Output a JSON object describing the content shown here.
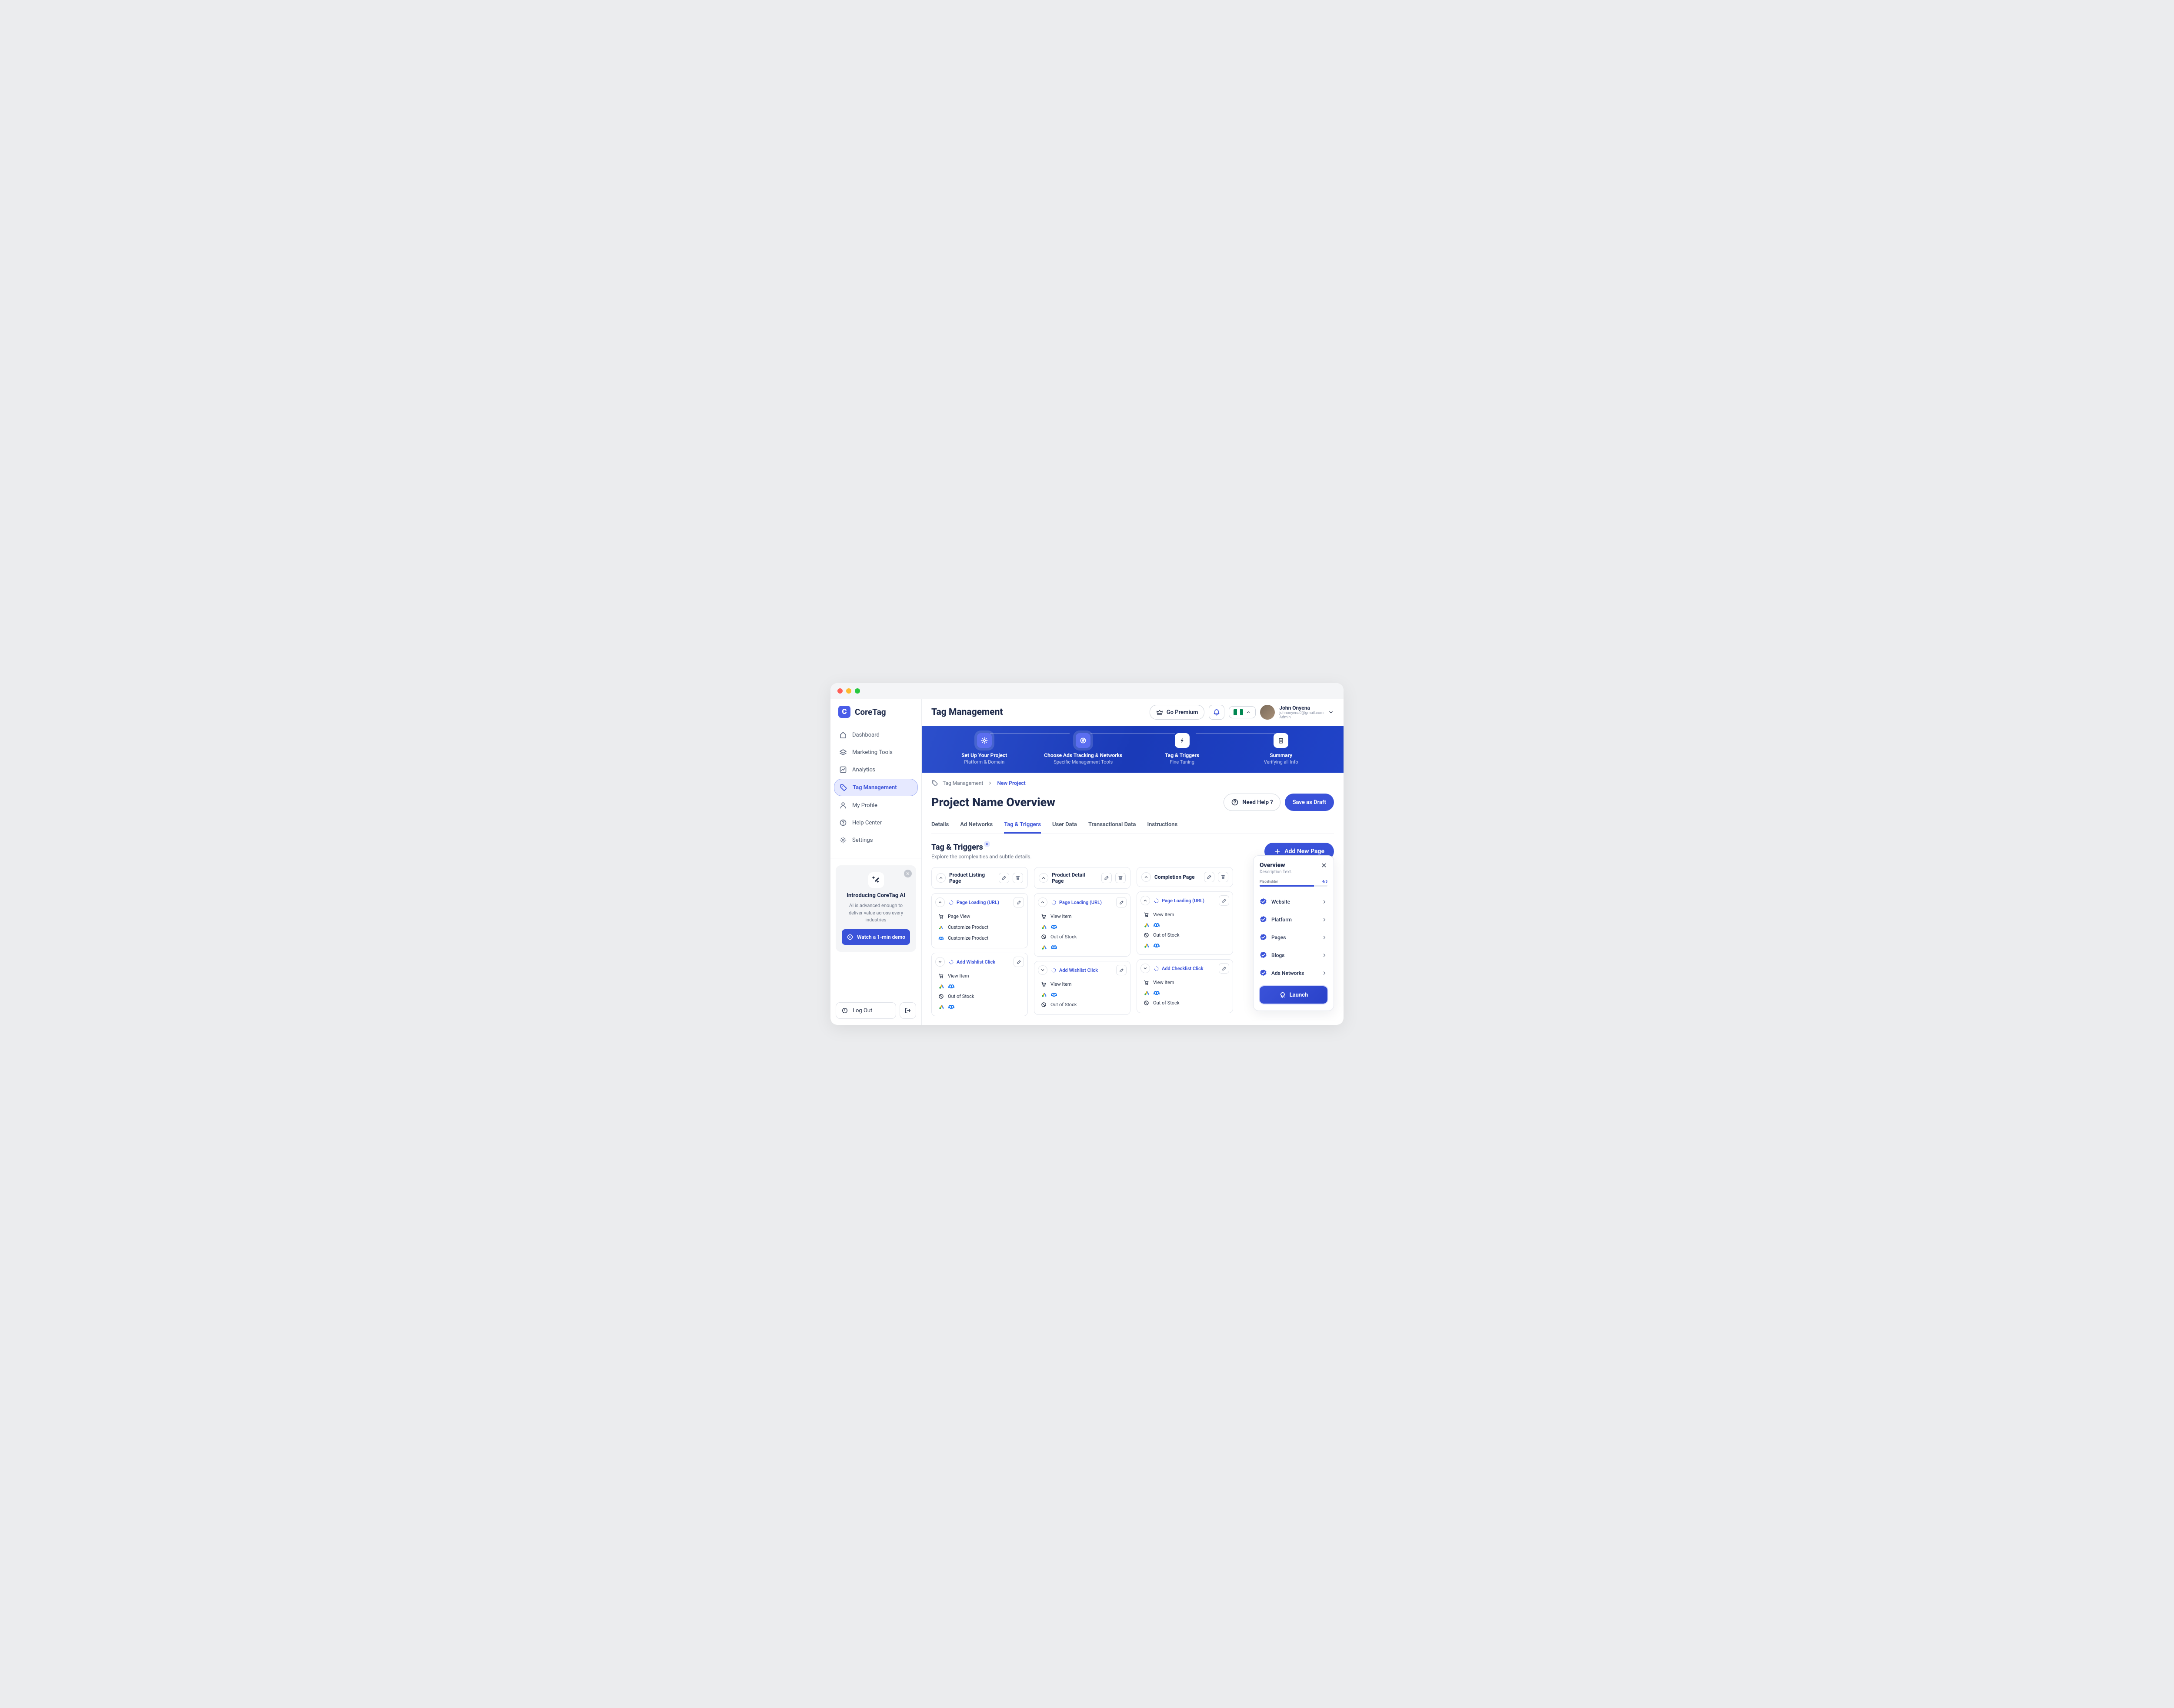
{
  "brand": {
    "logo_letter": "C",
    "name": "CoreTag"
  },
  "nav": [
    {
      "label": "Dashboard"
    },
    {
      "label": "Marketing Tools"
    },
    {
      "label": "Analytics"
    },
    {
      "label": "Tag Management"
    },
    {
      "label": "My Profile"
    },
    {
      "label": "Help Center"
    },
    {
      "label": "Settings"
    }
  ],
  "ai_card": {
    "title": "Introducing CoreTag AI",
    "text": "AI is advanced enough to deliver value across every industries",
    "button": "Watch a 1-min demo"
  },
  "logout_label": "Log Out",
  "topbar": {
    "title": "Tag Management",
    "premium_label": "Go Premium",
    "user": {
      "name": "John Onyena",
      "email": "johnonyena0@gmail.com",
      "role": "Admin"
    }
  },
  "stepper": [
    {
      "title": "Set Up Your Project",
      "sub": "Platform & Domain"
    },
    {
      "title": "Choose Ads Tracking & Networks",
      "sub": "Specific Management Tools"
    },
    {
      "title": "Tag & Triggers",
      "sub": "Fine Tuning"
    },
    {
      "title": "Summary",
      "sub": "Verifying all Info"
    }
  ],
  "breadcrumbs": {
    "root": "Tag Management",
    "current": "New Project"
  },
  "header": {
    "title": "Project Name Overview",
    "help": "Need Help ?",
    "save": "Save as Draft"
  },
  "tabs": [
    "Details",
    "Ad Networks",
    "Tag & Triggers",
    "User Data",
    "Transactional Data",
    "Instructions"
  ],
  "section": {
    "title": "Tag & Triggers",
    "badge": "8",
    "sub": "Explore the complexities and subtle details.",
    "add_page": "Add New Page"
  },
  "columns": [
    {
      "title": "Product Listing Page",
      "cards": [
        {
          "head": "Page Loading (URL)",
          "head_collapsed": false,
          "items": [
            {
              "icon": "cart",
              "label": "Page View"
            },
            {
              "icon": "gads",
              "label": "Customize Product"
            },
            {
              "icon": "meta",
              "label": "Customize Product"
            }
          ]
        },
        {
          "head": "Add Wishlist Click",
          "head_collapsed": true,
          "items": [
            {
              "icon": "cart",
              "label": "View Item"
            },
            {
              "icon": "gads-meta",
              "label": ""
            },
            {
              "icon": "ban",
              "label": "Out of Stock"
            },
            {
              "icon": "gads-meta",
              "label": ""
            }
          ]
        }
      ]
    },
    {
      "title": "Product Detail Page",
      "cards": [
        {
          "head": "Page Loading (URL)",
          "head_collapsed": false,
          "items": [
            {
              "icon": "cart",
              "label": "View Item"
            },
            {
              "icon": "gads-meta",
              "label": ""
            },
            {
              "icon": "ban",
              "label": "Out of Stock"
            },
            {
              "icon": "gads-meta",
              "label": ""
            }
          ]
        },
        {
          "head": "Add Wishlist Click",
          "head_collapsed": true,
          "items": [
            {
              "icon": "cart",
              "label": "View Item"
            },
            {
              "icon": "gads-meta",
              "label": ""
            },
            {
              "icon": "ban",
              "label": "Out of Stock"
            }
          ]
        }
      ]
    },
    {
      "title": "Completion Page",
      "cards": [
        {
          "head": "Page Loading (URL)",
          "head_collapsed": false,
          "items": [
            {
              "icon": "cart",
              "label": "View Item"
            },
            {
              "icon": "gads-meta",
              "label": ""
            },
            {
              "icon": "ban",
              "label": "Out of Stock"
            },
            {
              "icon": "gads-meta",
              "label": ""
            }
          ]
        },
        {
          "head": "Add Checklist Click",
          "head_collapsed": true,
          "items": [
            {
              "icon": "cart",
              "label": "View Item"
            },
            {
              "icon": "gads-meta",
              "label": ""
            },
            {
              "icon": "ban",
              "label": "Out of Stock"
            }
          ]
        }
      ]
    }
  ],
  "overview": {
    "title": "Overview",
    "sub": "Description Text.",
    "progress_label": "Placeholder",
    "progress_value": "4/5",
    "items": [
      "Website",
      "Platform",
      "Pages",
      "Blogs",
      "Ads Networks"
    ],
    "launch": "Launch"
  }
}
